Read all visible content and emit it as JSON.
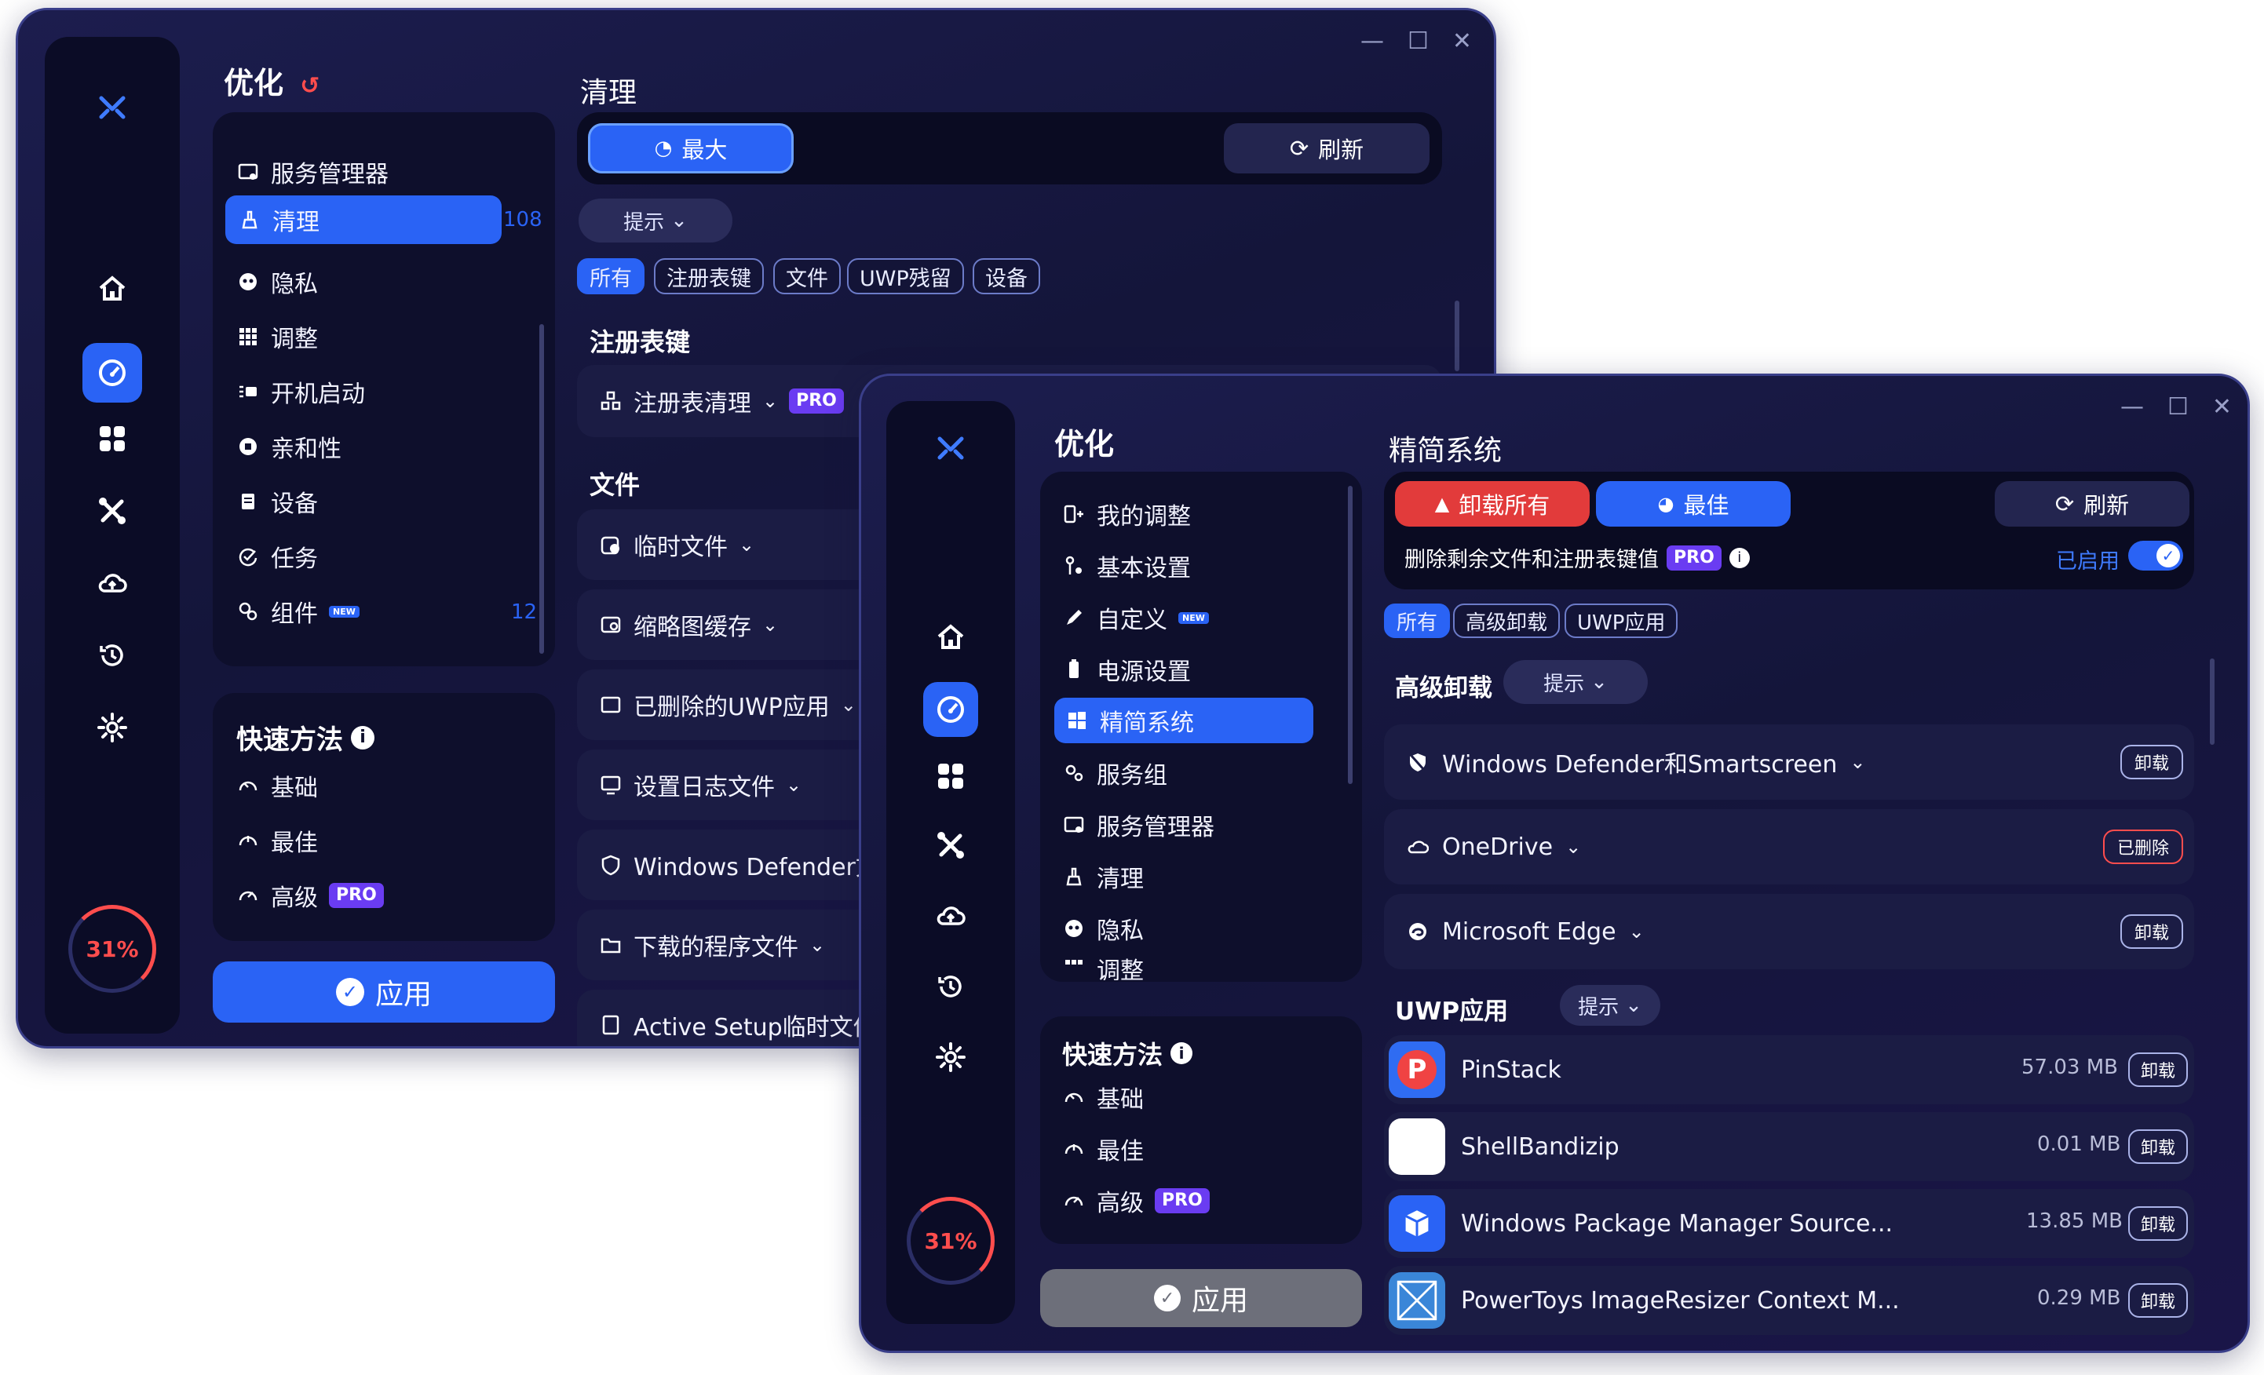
{
  "back": {
    "title": "优化",
    "counter_top": "108",
    "counter_bottom": "12",
    "nav": [
      {
        "label": "服务管理器",
        "icon": "service-icon"
      },
      {
        "label": "清理",
        "icon": "broom-icon"
      },
      {
        "label": "隐私",
        "icon": "privacy-icon"
      },
      {
        "label": "调整",
        "icon": "grid-icon"
      },
      {
        "label": "开机启动",
        "icon": "startup-icon"
      },
      {
        "label": "亲和性",
        "icon": "affinity-icon"
      },
      {
        "label": "设备",
        "icon": "device-icon"
      },
      {
        "label": "任务",
        "icon": "task-icon"
      },
      {
        "label": "组件",
        "icon": "component-icon"
      }
    ],
    "quick": {
      "title": "快速方法",
      "items": [
        "基础",
        "最佳",
        "高级"
      ]
    },
    "pro": "PRO",
    "new_badge": "NEW",
    "apply": "应用",
    "progress": "31%",
    "panel_title": "清理",
    "max_btn": "最大",
    "refresh_btn": "刷新",
    "hint_btn": "提示",
    "chips": [
      "所有",
      "注册表键",
      "文件",
      "UWP残留",
      "设备"
    ],
    "section_registry": "注册表键",
    "registry_row": "注册表清理",
    "section_files": "文件",
    "file_rows": [
      "临时文件",
      "缩略图缓存",
      "已删除的UWP应用",
      "设置日志文件",
      "Windows Defender文件",
      "下载的程序文件",
      "Active Setup临时文件"
    ]
  },
  "front": {
    "title": "优化",
    "nav": [
      {
        "label": "我的调整",
        "icon": "my-tweaks-icon"
      },
      {
        "label": "基本设置",
        "icon": "basic-settings-icon"
      },
      {
        "label": "自定义",
        "icon": "pen-icon"
      },
      {
        "label": "电源设置",
        "icon": "battery-icon"
      },
      {
        "label": "精简系统",
        "icon": "windows-icon"
      },
      {
        "label": "服务组",
        "icon": "gears-icon"
      },
      {
        "label": "服务管理器",
        "icon": "service-icon"
      },
      {
        "label": "清理",
        "icon": "broom-icon"
      },
      {
        "label": "隐私",
        "icon": "privacy-icon"
      },
      {
        "label": "调整",
        "icon": "grid-icon"
      }
    ],
    "quick": {
      "title": "快速方法",
      "items": [
        "基础",
        "最佳",
        "高级"
      ]
    },
    "pro": "PRO",
    "new_badge": "NEW",
    "apply": "应用",
    "progress": "31%",
    "panel_title": "精简系统",
    "uninstall_all": "卸载所有",
    "best_btn": "最佳",
    "refresh_btn": "刷新",
    "remove_leftovers": "删除剩余文件和注册表键值",
    "enabled": "已启用",
    "chips": [
      "所有",
      "高级卸载",
      "UWP应用"
    ],
    "section_advanced": "高级卸载",
    "hint_btn": "提示",
    "advanced_rows": [
      {
        "name": "Windows Defender和Smartscreen",
        "action": "卸载",
        "icon": "shield-icon"
      },
      {
        "name": "OneDrive",
        "action": "已删除",
        "icon": "cloud-icon"
      },
      {
        "name": "Microsoft Edge",
        "action": "卸载",
        "icon": "edge-icon"
      }
    ],
    "section_uwp": "UWP应用",
    "uwp_rows": [
      {
        "name": "PinStack",
        "size": "57.03 MB",
        "action": "卸载"
      },
      {
        "name": "ShellBandizip",
        "size": "0.01 MB",
        "action": "卸载"
      },
      {
        "name": "Windows Package Manager Source...",
        "size": "13.85 MB",
        "action": "卸载"
      },
      {
        "name": "PowerToys ImageResizer Context M...",
        "size": "0.29 MB",
        "action": "卸载"
      }
    ]
  },
  "colors": {
    "accent": "#2a63f5",
    "danger": "#f04343",
    "pro": "#6a3cf2",
    "bg": "#14153a"
  }
}
